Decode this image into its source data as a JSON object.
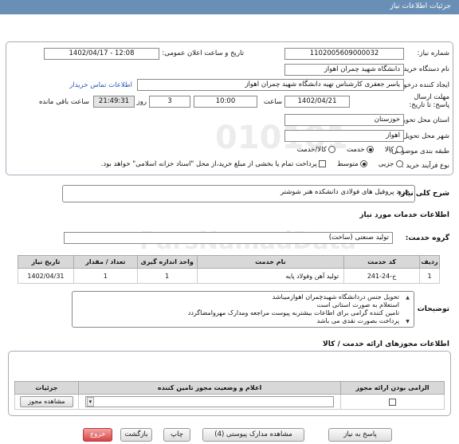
{
  "header": {
    "title": "جزئیات اطلاعات نیاز"
  },
  "form": {
    "need_number_label": "شماره نیاز:",
    "need_number": "1102005609000032",
    "announce_label": "تاریخ و ساعت اعلان عمومی:",
    "announce_value": "1402/04/17 - 12:08",
    "buyer_label": "نام دستگاه خریدار:",
    "buyer_value": "دانشگاه شهید چمران اهواز",
    "creator_label": "ایجاد کننده درخواست:",
    "creator_value": "یاسر جعفری کارشناس تهیه دانشگاه شهید چمران اهواز",
    "contact_link": "اطلاعات تماس خریدار",
    "deadline_label": "مهلت ارسال پاسخ: تا تاریخ:",
    "deadline_date": "1402/04/21",
    "time_label": "ساعت",
    "deadline_time": "10:00",
    "days_value": "3",
    "days_label": "روز و",
    "remaining_time": "21:49:31",
    "remaining_label": "ساعت باقی مانده",
    "province_label": "استان محل تحویل:",
    "province_value": "خوزستان",
    "city_label": "شهر محل تحویل:",
    "city_value": "اهواز",
    "category_label": "طبقه بندی موضوعی:",
    "category_options": [
      "کالا",
      "خدمت",
      "کالا/خدمت"
    ],
    "category_selected": "خدمت",
    "process_label": "نوع فرآیند خرید :",
    "process_options": [
      "جزیی",
      "متوسط"
    ],
    "process_selected": "متوسط",
    "payment_note": "پرداخت تمام یا بخشی از مبلغ خرید،از محل \"اسناد خزانه اسلامی\" خواهد بود."
  },
  "general_desc": {
    "label": "شرح کلی نیاز:",
    "value": "خرید پروفیل های فولادی دانشکده هنر شوشتر"
  },
  "services_section": {
    "title": "اطلاعات خدمات مورد نیاز"
  },
  "service_group": {
    "label": "گروه خدمت:",
    "value": "تولید صنعتی (ساخت)"
  },
  "items_table": {
    "headers": [
      "ردیف",
      "کد خدمت",
      "نام خدمت",
      "واحد اندازه گیری",
      "تعداد / مقدار",
      "تاریخ نیاز"
    ],
    "rows": [
      [
        "1",
        "خ-24-241",
        "تولید آهن وفولاد پایه",
        "1",
        "1",
        "1402/04/31"
      ]
    ]
  },
  "buyer_notes": {
    "label": "توضیحات خریدار:",
    "lines": [
      "تحویل جنس دردانشگاه شهیدچمران اهوازمیباشد",
      "استعلام به صورت استانی است",
      "تامین کننده گرامی برای اطاعات بیشتربه پیوست مراجعه ومدارک مهروامضاگردد",
      "پرداخت بصورت نقدی  می باشد"
    ]
  },
  "permits_section": {
    "title": "اطلاعات مجوزهای ارائه خدمت / کالا"
  },
  "permits_table": {
    "headers": [
      "الزامی بودن ارائه مجوز",
      "اعلام و وضعیت مجوز تامین کننده",
      "جزئیات"
    ],
    "view_button": "مشاهده مجوز"
  },
  "watermark": {
    "line1": "ParsNamadData",
    "line2": "۰۲۱-۸۸۳۴۹۶۷۰",
    "digits": "010101"
  },
  "buttons": {
    "reply": "پاسخ به نیاز",
    "docs": "مشاهده مدارک پیوستی (4)",
    "print": "چاپ",
    "back": "بازگشت",
    "exit": "خروج"
  }
}
